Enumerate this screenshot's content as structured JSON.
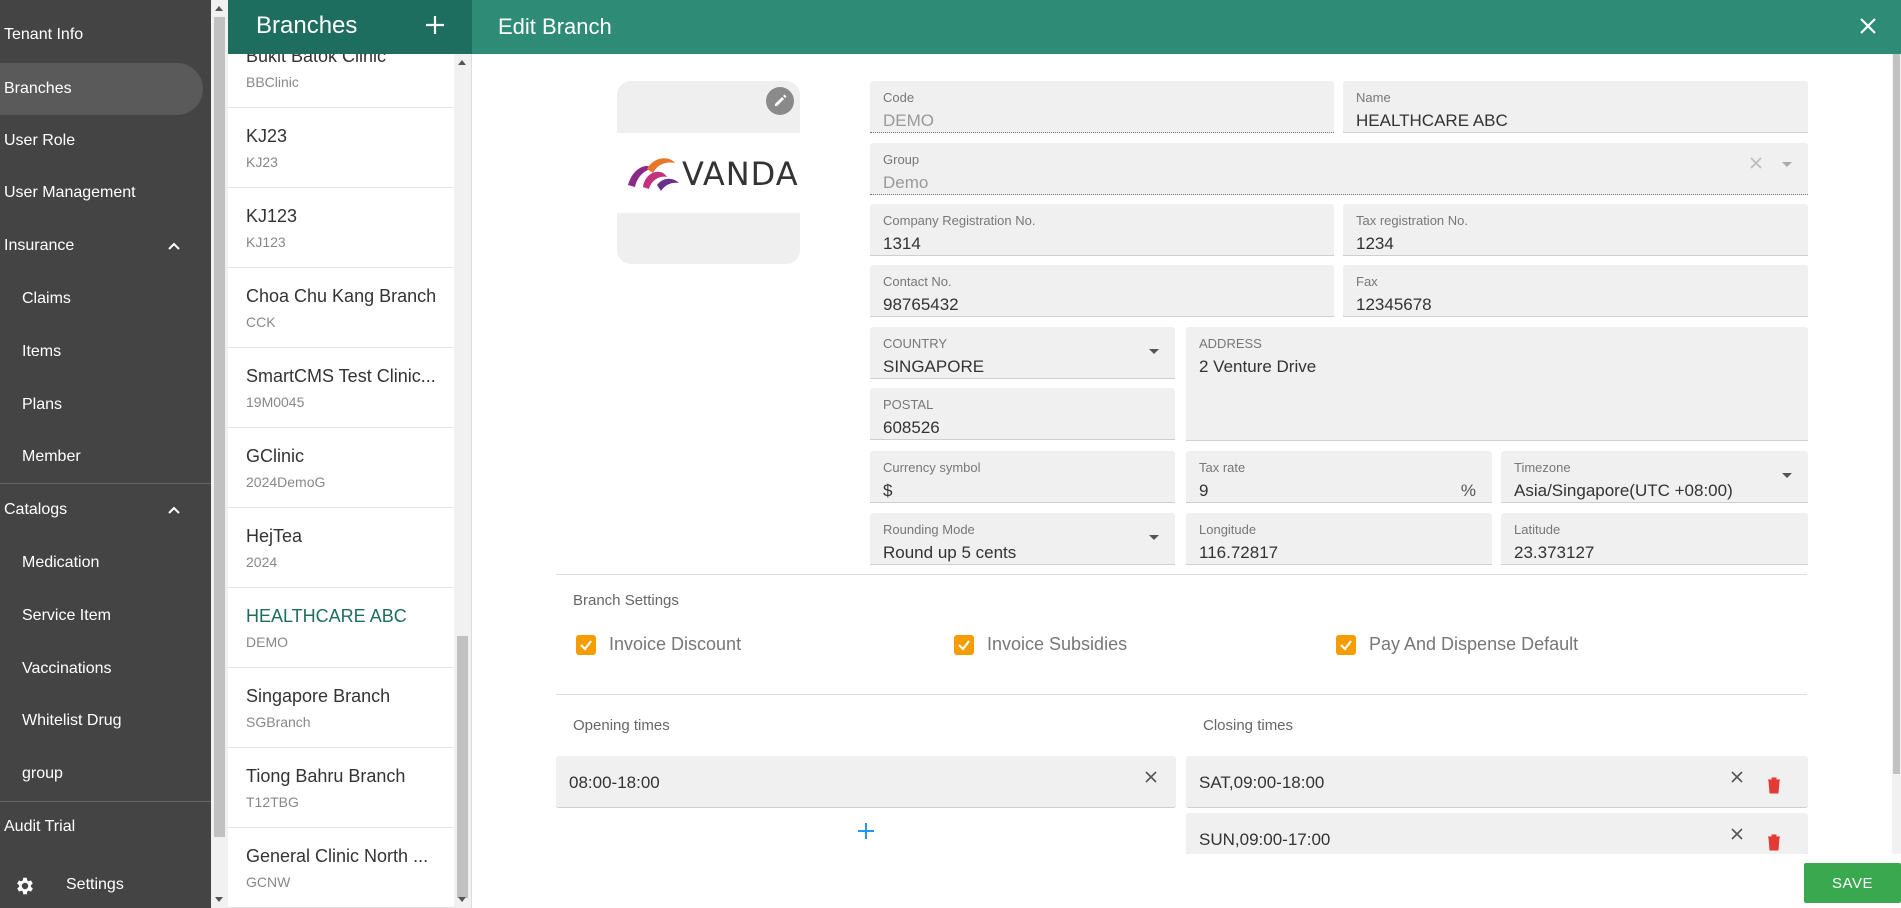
{
  "nav": {
    "items": [
      {
        "label": "Tenant Info"
      },
      {
        "label": "Branches"
      },
      {
        "label": "User Role"
      },
      {
        "label": "User Management"
      },
      {
        "label": "Insurance"
      },
      {
        "label": "Claims"
      },
      {
        "label": "Items"
      },
      {
        "label": "Plans"
      },
      {
        "label": "Member"
      },
      {
        "label": "Catalogs"
      },
      {
        "label": "Medication"
      },
      {
        "label": "Service Item"
      },
      {
        "label": "Vaccinations"
      },
      {
        "label": "Whitelist Drug"
      },
      {
        "label": "group"
      },
      {
        "label": "Audit Trial"
      }
    ],
    "settings_label": "Settings"
  },
  "branches_panel": {
    "title": "Branches",
    "items": [
      {
        "name": "Bukit Batok Clinic",
        "code": "BBClinic"
      },
      {
        "name": "KJ23",
        "code": "KJ23"
      },
      {
        "name": "KJ123",
        "code": "KJ123"
      },
      {
        "name": "Choa Chu Kang Branch",
        "code": "CCK"
      },
      {
        "name": "SmartCMS Test Clinic...",
        "code": "19M0045"
      },
      {
        "name": "GClinic",
        "code": "2024DemoG"
      },
      {
        "name": "HejTea",
        "code": "2024"
      },
      {
        "name": "HEALTHCARE ABC",
        "code": "DEMO"
      },
      {
        "name": "Singapore Branch",
        "code": "SGBranch"
      },
      {
        "name": "Tiong Bahru Branch",
        "code": "T12TBG"
      },
      {
        "name": "General Clinic North ...",
        "code": "GCNW"
      }
    ]
  },
  "edit": {
    "title": "Edit Branch",
    "logo_text": "VANDA",
    "fields": {
      "code": {
        "label": "Code",
        "value": "DEMO"
      },
      "name": {
        "label": "Name",
        "value": "HEALTHCARE ABC"
      },
      "group": {
        "label": "Group",
        "value": "Demo"
      },
      "company_reg": {
        "label": "Company Registration No.",
        "value": "1314"
      },
      "tax_reg": {
        "label": "Tax registration No.",
        "value": "1234"
      },
      "contact": {
        "label": "Contact No.",
        "value": "98765432"
      },
      "fax": {
        "label": "Fax",
        "value": "12345678"
      },
      "country": {
        "label": "COUNTRY",
        "value": "SINGAPORE"
      },
      "address": {
        "label": "ADDRESS",
        "value": "2 Venture Drive"
      },
      "postal": {
        "label": "POSTAL",
        "value": "608526"
      },
      "currency": {
        "label": "Currency symbol",
        "value": "$"
      },
      "tax_rate": {
        "label": "Tax rate",
        "value": "9",
        "suffix": "%"
      },
      "timezone": {
        "label": "Timezone",
        "value": "Asia/Singapore(UTC +08:00)"
      },
      "rounding": {
        "label": "Rounding Mode",
        "value": "Round up 5 cents"
      },
      "longitude": {
        "label": "Longitude",
        "value": "116.72817"
      },
      "latitude": {
        "label": "Latitude",
        "value": "23.373127"
      }
    },
    "branch_settings": {
      "title": "Branch Settings",
      "invoice_discount": "Invoice Discount",
      "invoice_subsidies": "Invoice Subsidies",
      "pay_dispense": "Pay And Dispense Default"
    },
    "opening": {
      "title": "Opening times",
      "items": [
        "08:00-18:00"
      ]
    },
    "closing": {
      "title": "Closing times",
      "items": [
        "SAT,09:00-18:00",
        "SUN,09:00-17:00"
      ]
    },
    "save_label": "SAVE"
  },
  "colors": {
    "nav_bg": "#444444",
    "list_header": "#1e6e5f",
    "edit_header": "#2e8b76",
    "checkbox": "#f59c00",
    "save": "#3aa84e",
    "delete": "#e53935"
  }
}
